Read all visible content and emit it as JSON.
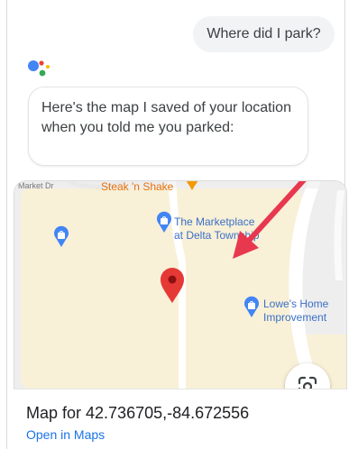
{
  "conversation": {
    "user_query": "Where did I park?",
    "assistant_reply": "Here's the map I saved of your location when you told me you parked:"
  },
  "map": {
    "labels": {
      "market_dr": "Market Dr",
      "steak_n_shake": "Steak 'n Shake",
      "marketplace_line1": "The Marketplace",
      "marketplace_line2": "at Delta Township",
      "lowes_line1": "Lowe's Home",
      "lowes_line2": "Improvement"
    },
    "icons": {
      "parked_pin": "red-location-pin",
      "shopping_pins": "shopping-bag-pin",
      "restaurant_pin": "restaurant-pin",
      "lens": "google-lens-icon",
      "annotation": "red-arrow"
    },
    "colors": {
      "land": "#f8f0d7",
      "road": "#ffffff",
      "poi_blue": "#4285f4",
      "pin_red": "#e53935",
      "arrow_red": "#e8384f",
      "link_blue": "#1a73e8"
    },
    "title": "Map for 42.736705,-84.672556",
    "open_link": "Open in Maps"
  }
}
